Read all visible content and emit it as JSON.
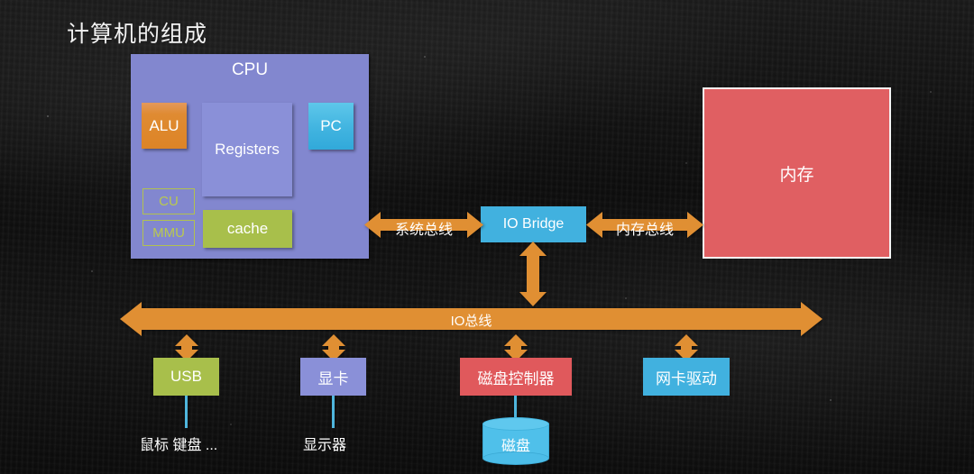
{
  "slide": {
    "title": "计算机的组成",
    "background": "#131313"
  },
  "cpu": {
    "label": "CPU",
    "color": "#8287cf",
    "units": {
      "alu": "ALU",
      "registers": "Registers",
      "pc": "PC",
      "cu": "CU",
      "mmu": "MMU",
      "cache": "cache"
    }
  },
  "bridge": {
    "label": "IO Bridge",
    "color": "#41b1df"
  },
  "memory": {
    "label": "内存",
    "color": "#e05f62"
  },
  "buses": {
    "system_bus": "系统总线",
    "memory_bus": "内存总线",
    "io_bus": "IO总线",
    "color": "#e08f33"
  },
  "devices": [
    {
      "label": "USB",
      "color": "#a8bf4b"
    },
    {
      "label": "显卡",
      "color": "#8a90d8"
    },
    {
      "label": "磁盘控制器",
      "color": "#e0595c"
    },
    {
      "label": "网卡驱动",
      "color": "#41b1df"
    }
  ],
  "peripherals": {
    "input_devices": "鼠标 键盘 ...",
    "monitor": "显示器",
    "disk": "磁盘"
  }
}
